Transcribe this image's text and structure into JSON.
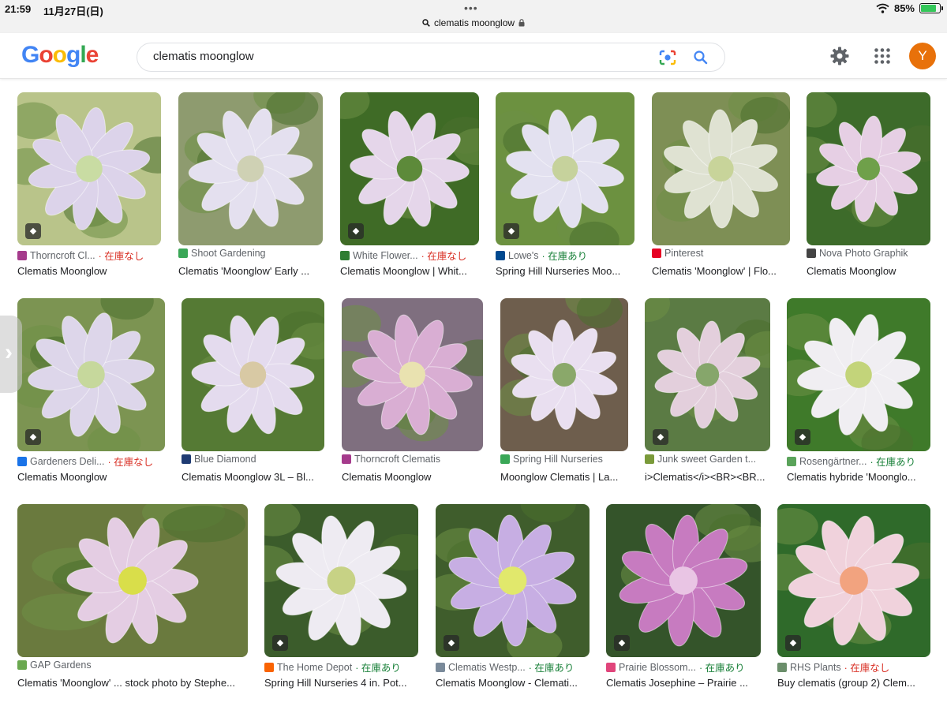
{
  "status_bar": {
    "time": "21:59",
    "date": "11月27日(日)",
    "dots": "•••",
    "url": "clematis moonglow",
    "battery_percent": "85%",
    "battery_level": 0.85
  },
  "header": {
    "logo": [
      "G",
      "o",
      "o",
      "g",
      "l",
      "e"
    ],
    "logo_colors": [
      "#4285f4",
      "#ea4335",
      "#fbbc05",
      "#4285f4",
      "#34a853",
      "#ea4335"
    ],
    "search_value": "clematis moonglow",
    "avatar_letter": "Y"
  },
  "results": [
    {
      "source": "Thorncroft Cl...",
      "stock": "· 在庫なし",
      "stock_type": "out",
      "title": "Clematis Moonglow",
      "fav": "#a53b8c",
      "colors": [
        "#dcd3ea",
        "#c9dca3",
        "#b9c48a"
      ],
      "tag": true
    },
    {
      "source": "Shoot Gardening",
      "stock": "",
      "stock_type": "",
      "title": "Clematis 'Moonglow' Early ...",
      "fav": "#3aa757",
      "colors": [
        "#e4e0ef",
        "#cfd1b4",
        "#8e9b6f"
      ],
      "tag": false
    },
    {
      "source": "White Flower...",
      "stock": "· 在庫なし",
      "stock_type": "out",
      "title": "Clematis Moonglow | Whit...",
      "fav": "#2e7d32",
      "colors": [
        "#e5d6ea",
        "#5d8a3a",
        "#3f6b26"
      ],
      "tag": true
    },
    {
      "source": "Lowe's",
      "stock": "· 在庫あり",
      "stock_type": "in",
      "title": "Spring Hill Nurseries Moo...",
      "fav": "#004990",
      "colors": [
        "#e3e1f0",
        "#c6d29c",
        "#6c9140"
      ],
      "tag": true
    },
    {
      "source": "Pinterest",
      "stock": "",
      "stock_type": "",
      "title": "Clematis 'Moonglow' | Flo...",
      "fav": "#e60023",
      "colors": [
        "#dfe2d2",
        "#c8d49a",
        "#7e8f55"
      ],
      "tag": false
    },
    {
      "source": "Nova Photo Graphik",
      "stock": "",
      "stock_type": "",
      "title": "Clematis Moonglow",
      "fav": "#444444",
      "colors": [
        "#e6cfe4",
        "#6fa04a",
        "#3d6b2a"
      ],
      "tag": false
    },
    {
      "source": "Gardeners Deli...",
      "stock": "· 在庫なし",
      "stock_type": "out",
      "title": "Clematis Moonglow",
      "fav": "#1a73e8",
      "colors": [
        "#ddd6ea",
        "#c6d89c",
        "#7c9452"
      ],
      "tag": true
    },
    {
      "source": "Blue Diamond",
      "stock": "",
      "stock_type": "",
      "title": "Clematis Moonglow 3L – Bl...",
      "fav": "#1f3b73",
      "colors": [
        "#e4dbee",
        "#d8c9a4",
        "#557a34"
      ],
      "tag": false
    },
    {
      "source": "Thorncroft Clematis",
      "stock": "",
      "stock_type": "",
      "title": "Clematis Moonglow",
      "fav": "#a53b8c",
      "colors": [
        "#d9aed3",
        "#e9e2b0",
        "#7f6f7f"
      ],
      "tag": false
    },
    {
      "source": "Spring Hill Nurseries",
      "stock": "",
      "stock_type": "",
      "title": "Moonglow Clematis | La...",
      "fav": "#3aa757",
      "colors": [
        "#e9dff0",
        "#8aa86a",
        "#6e5e4d"
      ],
      "tag": false
    },
    {
      "source": "Junk sweet Garden t...",
      "stock": "",
      "stock_type": "",
      "title": "i>Clematis</i><BR><BR...",
      "fav": "#7a9a3a",
      "colors": [
        "#e3cfdc",
        "#86a66b",
        "#5b7b44"
      ],
      "tag": true
    },
    {
      "source": "Rosengärtner...",
      "stock": "· 在庫あり",
      "stock_type": "in",
      "title": "Clematis hybride 'Moonglo...",
      "fav": "#5aa35a",
      "colors": [
        "#f0eef2",
        "#c3d47a",
        "#3f7a2a"
      ],
      "tag": true
    },
    {
      "source": "GAP Gardens",
      "stock": "",
      "stock_type": "",
      "title": "Clematis 'Moonglow' ... stock photo by Stephe...",
      "fav": "#6aa84f",
      "colors": [
        "#e4cde3",
        "#d9de4a",
        "#6a7a3e"
      ],
      "tag": false
    },
    {
      "source": "The Home Depot",
      "stock": "· 在庫あり",
      "stock_type": "in",
      "title": "Spring Hill Nurseries 4 in. Pot...",
      "fav": "#f96302",
      "colors": [
        "#eeebf2",
        "#c7d285",
        "#3b5c2b"
      ],
      "tag": true
    },
    {
      "source": "Clematis Westp...",
      "stock": "· 在庫あり",
      "stock_type": "in",
      "title": "Clematis Moonglow - Clemati...",
      "fav": "#7a8a9a",
      "colors": [
        "#c7aee3",
        "#e1e86c",
        "#3f5d2c"
      ],
      "tag": true
    },
    {
      "source": "Prairie Blossom...",
      "stock": "· 在庫あり",
      "stock_type": "in",
      "title": "Clematis Josephine – Prairie ...",
      "fav": "#e0457b",
      "colors": [
        "#c77bc0",
        "#e9c5e4",
        "#34542a"
      ],
      "tag": true
    },
    {
      "source": "RHS Plants",
      "stock": "· 在庫なし",
      "stock_type": "out",
      "title": "Buy clematis (group 2) Clem...",
      "fav": "#6b8e6b",
      "colors": [
        "#f0d2dc",
        "#f2a37f",
        "#2f6a2a"
      ],
      "tag": true
    }
  ]
}
